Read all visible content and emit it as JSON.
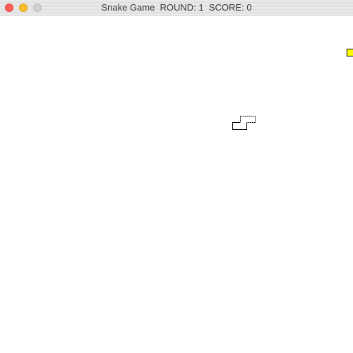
{
  "window": {
    "title": "Snake Game  ROUND: 1  SCORE: 0"
  },
  "game": {
    "round": 1,
    "score": 0,
    "food_color": "#ffff00",
    "snake_color": "#ffffff",
    "snake_outline_color": "#000000"
  }
}
